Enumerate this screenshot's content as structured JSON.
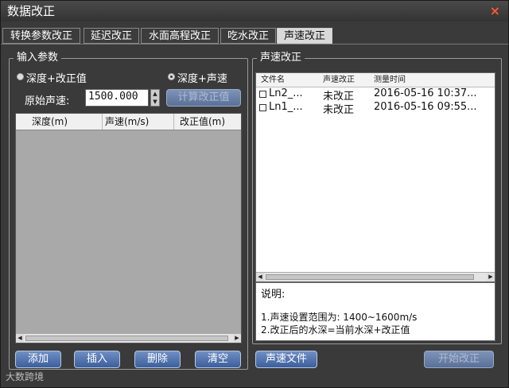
{
  "window": {
    "title": "数据改正",
    "close_glyph": "×"
  },
  "tabs": [
    {
      "label": "转换参数改正"
    },
    {
      "label": "延迟改正"
    },
    {
      "label": "水面高程改正"
    },
    {
      "label": "吃水改正"
    },
    {
      "label": "声速改正",
      "active": true
    }
  ],
  "left": {
    "group_title": "输入参数",
    "radio_depth_correction": {
      "label": "深度+改正值",
      "selected": false
    },
    "radio_depth_sound": {
      "label": "深度+声速",
      "selected": true
    },
    "sound_speed_label": "原始声速:",
    "sound_speed_value": "1500.000",
    "calc_button": "计算改正值",
    "table_headers": [
      "深度(m)",
      "声速(m/s)",
      "改正值(m)"
    ],
    "buttons": {
      "add": "添加",
      "insert": "插入",
      "delete": "删除",
      "clear": "清空"
    }
  },
  "right": {
    "group_title": "声速改正",
    "list_headers": [
      "文件名",
      "声速改正",
      "测量时间"
    ],
    "files": [
      {
        "name": "Ln2_...",
        "status": "未改正",
        "time": "2016-05-16 10:37..."
      },
      {
        "name": "Ln1_...",
        "status": "未改正",
        "time": "2016-05-16 09:55..."
      }
    ],
    "note_title": "说明:",
    "note_lines": [
      "1.声速设置范围为: 1400~1600m/s",
      "2.改正后的水深=当前水深+改正值"
    ],
    "sound_file_button": "声速文件",
    "start_button": "开始改正"
  },
  "watermark": "大数跨境",
  "colors": {
    "window_bg": "#3a3a3a",
    "button_blue": "#4a6aa8",
    "close_icon": "#ff5a2a",
    "active_tab": "#d9d9d9"
  }
}
